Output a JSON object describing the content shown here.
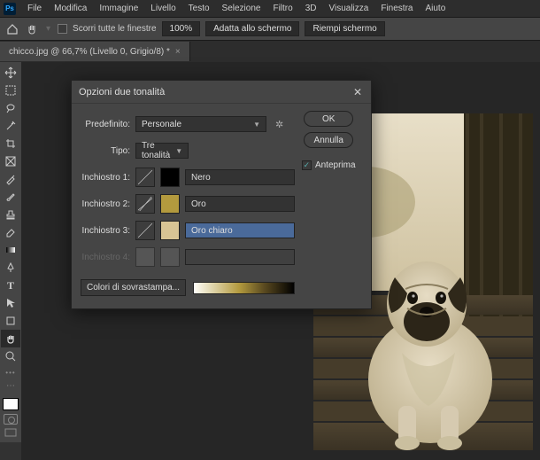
{
  "logo": "Ps",
  "menu": [
    "File",
    "Modifica",
    "Immagine",
    "Livello",
    "Testo",
    "Selezione",
    "Filtro",
    "3D",
    "Visualizza",
    "Finestra",
    "Aiuto"
  ],
  "toolbar": {
    "scroll_label": "Scorri tutte le finestre",
    "zoom": "100%",
    "fit_label": "Adatta allo schermo",
    "fill_label": "Riempi schermo"
  },
  "doc_tab": "chicco.jpg @ 66,7% (Livello 0, Grigio/8) *",
  "dialog": {
    "title": "Opzioni due tonalità",
    "preset_label": "Predefinito:",
    "preset_value": "Personale",
    "type_label": "Tipo:",
    "type_value": "Tre tonalità",
    "inks": [
      {
        "label": "Inchiostro 1:",
        "swatch": "#000000",
        "name": "Nero",
        "sel": false
      },
      {
        "label": "Inchiostro 2:",
        "swatch": "#b39a3e",
        "name": "Oro",
        "sel": false
      },
      {
        "label": "Inchiostro 3:",
        "swatch": "#d8c494",
        "name": "Oro chiaro",
        "sel": true
      },
      {
        "label": "Inchiostro 4:",
        "swatch": "",
        "name": "",
        "sel": false
      }
    ],
    "overprint_label": "Colori di sovrastampa...",
    "ok": "OK",
    "cancel": "Annulla",
    "preview_label": "Anteprima",
    "preview_checked": true
  }
}
